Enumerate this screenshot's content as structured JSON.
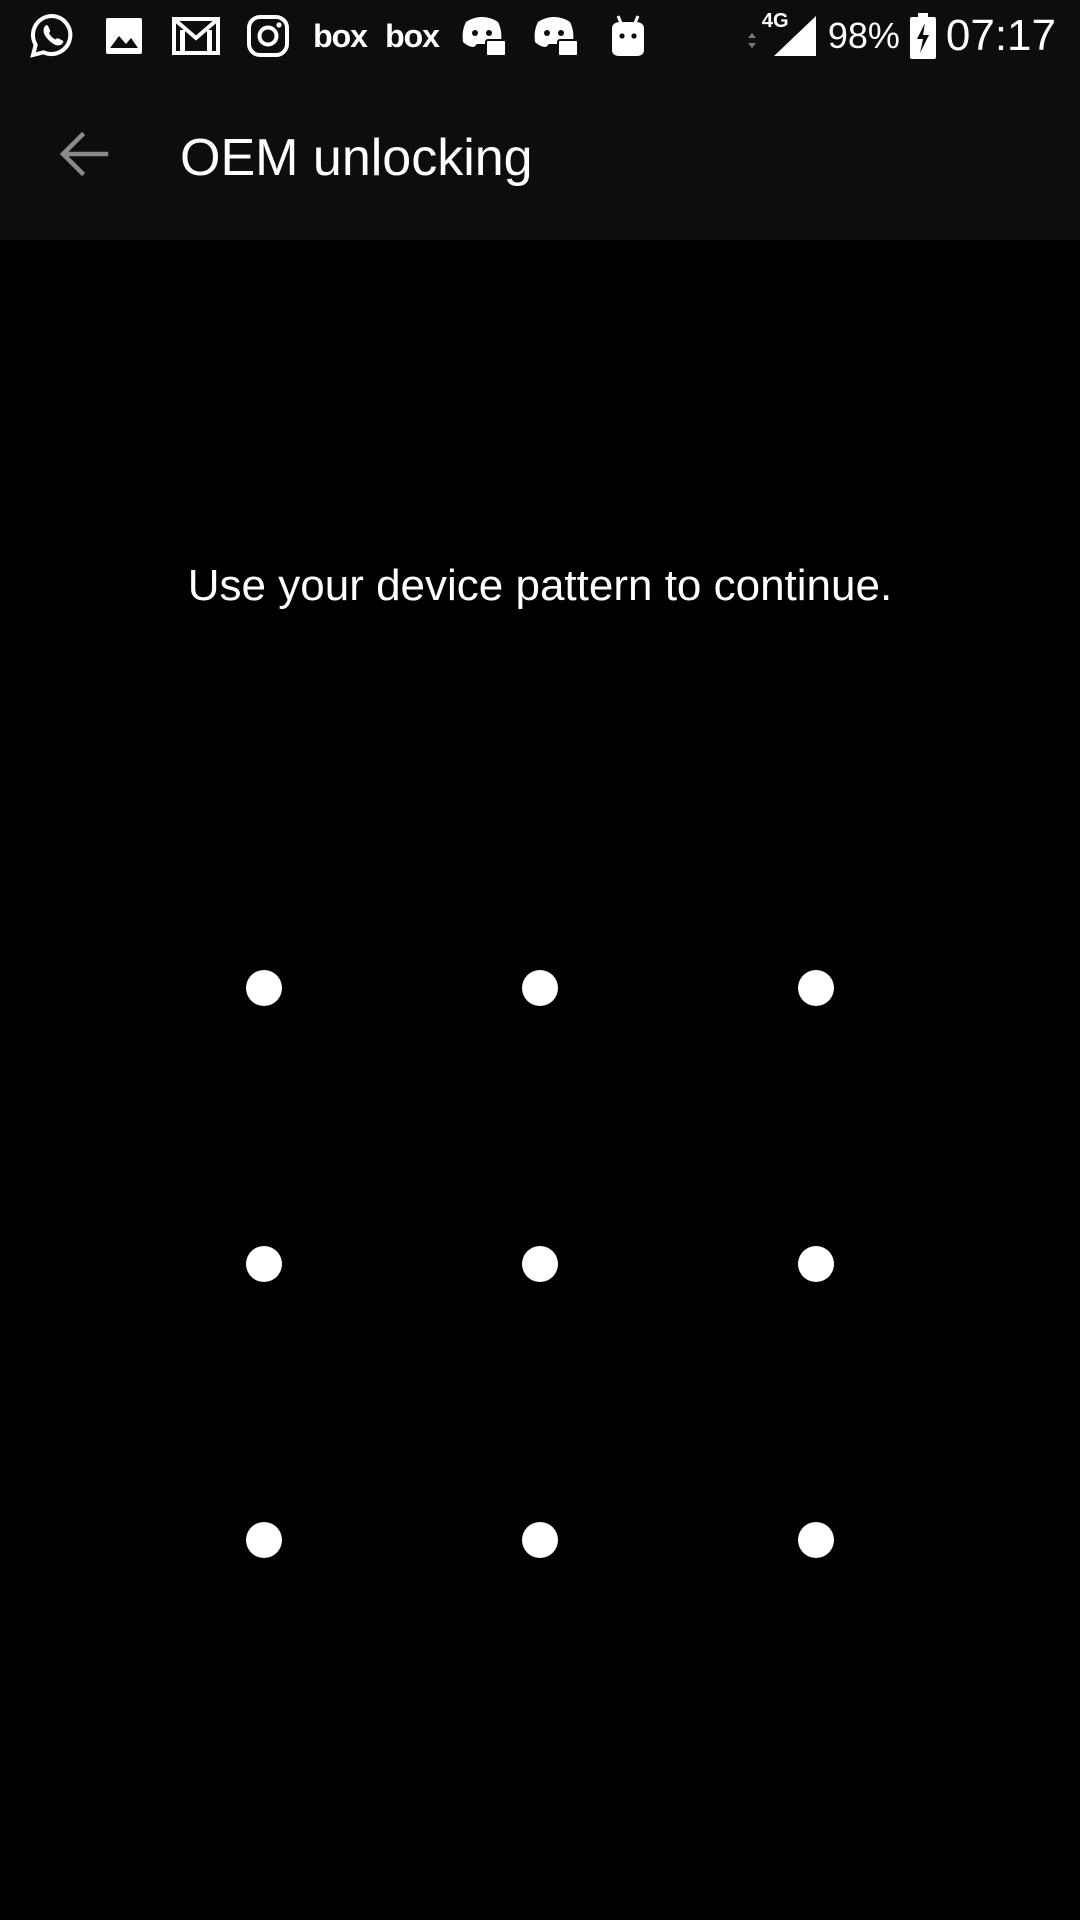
{
  "status_bar": {
    "notification_icons": [
      {
        "name": "whatsapp-icon"
      },
      {
        "name": "gallery-icon"
      },
      {
        "name": "gmail-icon"
      },
      {
        "name": "instagram-icon"
      },
      {
        "name": "box-icon",
        "text": "box"
      },
      {
        "name": "box-icon",
        "text": "box"
      },
      {
        "name": "discord-icon"
      },
      {
        "name": "discord-icon"
      },
      {
        "name": "android-icon"
      }
    ],
    "network_type": "4G",
    "battery_percent": "98%",
    "time": "07:17"
  },
  "toolbar": {
    "back_icon": "arrow-left-icon",
    "title": "OEM unlocking"
  },
  "prompt": {
    "text": "Use your device pattern to continue."
  },
  "pattern": {
    "rows": 3,
    "cols": 3,
    "dot_color": "#ffffff"
  },
  "colors": {
    "background": "#000000",
    "bar_background": "#0d0d0d",
    "text": "#ffffff",
    "back_arrow": "#8a8a8a"
  }
}
